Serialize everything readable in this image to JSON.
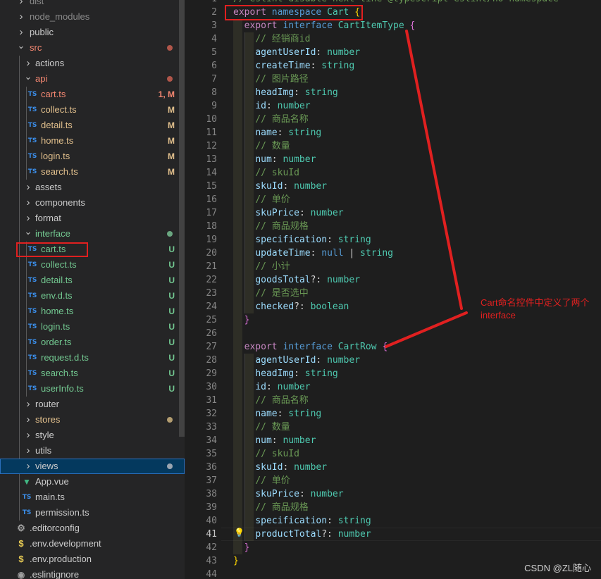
{
  "explorer": [
    {
      "label": "dist",
      "kind": "folder",
      "status": "muted"
    },
    {
      "label": "node_modules",
      "kind": "folder",
      "status": "muted"
    },
    {
      "label": "public",
      "kind": "folder"
    },
    {
      "label": "src",
      "kind": "folder-open",
      "status": "err",
      "badge": "dot"
    },
    {
      "label": "actions",
      "kind": "folder"
    },
    {
      "label": "api",
      "kind": "folder-open",
      "status": "err",
      "badge": "dot"
    },
    {
      "label": "cart.ts",
      "kind": "ts",
      "status": "err",
      "badge": "1, M"
    },
    {
      "label": "collect.ts",
      "kind": "ts",
      "status": "mod",
      "badge": "M"
    },
    {
      "label": "detail.ts",
      "kind": "ts",
      "status": "mod",
      "badge": "M"
    },
    {
      "label": "home.ts",
      "kind": "ts",
      "status": "mod",
      "badge": "M"
    },
    {
      "label": "login.ts",
      "kind": "ts",
      "status": "mod",
      "badge": "M"
    },
    {
      "label": "search.ts",
      "kind": "ts",
      "status": "mod",
      "badge": "M"
    },
    {
      "label": "assets",
      "kind": "folder"
    },
    {
      "label": "components",
      "kind": "folder"
    },
    {
      "label": "format",
      "kind": "folder"
    },
    {
      "label": "interface",
      "kind": "folder-open",
      "status": "unt",
      "badge": "dot"
    },
    {
      "label": "cart.ts",
      "kind": "ts",
      "status": "unt",
      "badge": "U"
    },
    {
      "label": "collect.ts",
      "kind": "ts",
      "status": "unt",
      "badge": "U"
    },
    {
      "label": "detail.ts",
      "kind": "ts",
      "status": "unt",
      "badge": "U"
    },
    {
      "label": "env.d.ts",
      "kind": "ts",
      "status": "unt",
      "badge": "U"
    },
    {
      "label": "home.ts",
      "kind": "ts",
      "status": "unt",
      "badge": "U"
    },
    {
      "label": "login.ts",
      "kind": "ts",
      "status": "unt",
      "badge": "U"
    },
    {
      "label": "order.ts",
      "kind": "ts",
      "status": "unt",
      "badge": "U"
    },
    {
      "label": "request.d.ts",
      "kind": "ts",
      "status": "unt",
      "badge": "U"
    },
    {
      "label": "search.ts",
      "kind": "ts",
      "status": "unt",
      "badge": "U"
    },
    {
      "label": "userInfo.ts",
      "kind": "ts",
      "status": "unt",
      "badge": "U"
    },
    {
      "label": "router",
      "kind": "folder"
    },
    {
      "label": "stores",
      "kind": "folder",
      "status": "mod",
      "badge": "dot"
    },
    {
      "label": "style",
      "kind": "folder"
    },
    {
      "label": "utils",
      "kind": "folder"
    },
    {
      "label": "views",
      "kind": "folder",
      "badge": "dot",
      "selected": true
    },
    {
      "label": "App.vue",
      "kind": "vue"
    },
    {
      "label": "main.ts",
      "kind": "ts"
    },
    {
      "label": "permission.ts",
      "kind": "ts"
    },
    {
      "label": ".editorconfig",
      "kind": "gear"
    },
    {
      "label": ".env.development",
      "kind": "env"
    },
    {
      "label": ".env.production",
      "kind": "env"
    },
    {
      "label": ".eslintignore",
      "kind": "dot"
    }
  ],
  "editor": {
    "active_line": 41,
    "lines": [
      {
        "n": 1,
        "t": [
          [
            "cm",
            "// eslint-disable-next-line @typescript-eslint/no-namespace"
          ]
        ]
      },
      {
        "n": 2,
        "t": [
          [
            "ctl",
            "export"
          ],
          [
            "pn",
            " "
          ],
          [
            "kw",
            "namespace"
          ],
          [
            "pn",
            " "
          ],
          [
            "ty",
            "Cart"
          ],
          [
            "pn",
            " "
          ],
          [
            "br1",
            "{"
          ]
        ]
      },
      {
        "n": 3,
        "t": [
          [
            "pn",
            "  "
          ],
          [
            "ctl",
            "export"
          ],
          [
            "pn",
            " "
          ],
          [
            "kw",
            "interface"
          ],
          [
            "pn",
            " "
          ],
          [
            "ty",
            "CartItemType"
          ],
          [
            "pn",
            " "
          ],
          [
            "br2",
            "{"
          ]
        ]
      },
      {
        "n": 4,
        "t": [
          [
            "pn",
            "    "
          ],
          [
            "cm",
            "// 经销商id"
          ]
        ]
      },
      {
        "n": 5,
        "t": [
          [
            "pn",
            "    "
          ],
          [
            "prop",
            "agentUserId"
          ],
          [
            "pn",
            ": "
          ],
          [
            "ty",
            "number"
          ]
        ]
      },
      {
        "n": 6,
        "t": [
          [
            "pn",
            "    "
          ],
          [
            "prop",
            "createTime"
          ],
          [
            "pn",
            ": "
          ],
          [
            "ty",
            "string"
          ]
        ]
      },
      {
        "n": 7,
        "t": [
          [
            "pn",
            "    "
          ],
          [
            "cm",
            "// 图片路径"
          ]
        ]
      },
      {
        "n": 8,
        "t": [
          [
            "pn",
            "    "
          ],
          [
            "prop",
            "headImg"
          ],
          [
            "pn",
            ": "
          ],
          [
            "ty",
            "string"
          ]
        ]
      },
      {
        "n": 9,
        "t": [
          [
            "pn",
            "    "
          ],
          [
            "prop",
            "id"
          ],
          [
            "pn",
            ": "
          ],
          [
            "ty",
            "number"
          ]
        ]
      },
      {
        "n": 10,
        "t": [
          [
            "pn",
            "    "
          ],
          [
            "cm",
            "// 商品名称"
          ]
        ]
      },
      {
        "n": 11,
        "t": [
          [
            "pn",
            "    "
          ],
          [
            "prop",
            "name"
          ],
          [
            "pn",
            ": "
          ],
          [
            "ty",
            "string"
          ]
        ]
      },
      {
        "n": 12,
        "t": [
          [
            "pn",
            "    "
          ],
          [
            "cm",
            "// 数量"
          ]
        ]
      },
      {
        "n": 13,
        "t": [
          [
            "pn",
            "    "
          ],
          [
            "prop",
            "num"
          ],
          [
            "pn",
            ": "
          ],
          [
            "ty",
            "number"
          ]
        ]
      },
      {
        "n": 14,
        "t": [
          [
            "pn",
            "    "
          ],
          [
            "cm",
            "// skuId"
          ]
        ]
      },
      {
        "n": 15,
        "t": [
          [
            "pn",
            "    "
          ],
          [
            "prop",
            "skuId"
          ],
          [
            "pn",
            ": "
          ],
          [
            "ty",
            "number"
          ]
        ]
      },
      {
        "n": 16,
        "t": [
          [
            "pn",
            "    "
          ],
          [
            "cm",
            "// 单价"
          ]
        ]
      },
      {
        "n": 17,
        "t": [
          [
            "pn",
            "    "
          ],
          [
            "prop",
            "skuPrice"
          ],
          [
            "pn",
            ": "
          ],
          [
            "ty",
            "number"
          ]
        ]
      },
      {
        "n": 18,
        "t": [
          [
            "pn",
            "    "
          ],
          [
            "cm",
            "// 商品规格"
          ]
        ]
      },
      {
        "n": 19,
        "t": [
          [
            "pn",
            "    "
          ],
          [
            "prop",
            "specification"
          ],
          [
            "pn",
            ": "
          ],
          [
            "ty",
            "string"
          ]
        ]
      },
      {
        "n": 20,
        "t": [
          [
            "pn",
            "    "
          ],
          [
            "prop",
            "updateTime"
          ],
          [
            "pn",
            ": "
          ],
          [
            "kw",
            "null"
          ],
          [
            "pn",
            " | "
          ],
          [
            "ty",
            "string"
          ]
        ]
      },
      {
        "n": 21,
        "t": [
          [
            "pn",
            "    "
          ],
          [
            "cm",
            "// 小计"
          ]
        ]
      },
      {
        "n": 22,
        "t": [
          [
            "pn",
            "    "
          ],
          [
            "prop",
            "goodsTotal"
          ],
          [
            "pn",
            "?: "
          ],
          [
            "ty",
            "number"
          ]
        ]
      },
      {
        "n": 23,
        "t": [
          [
            "pn",
            "    "
          ],
          [
            "cm",
            "// 是否选中"
          ]
        ]
      },
      {
        "n": 24,
        "t": [
          [
            "pn",
            "    "
          ],
          [
            "prop",
            "checked"
          ],
          [
            "pn",
            "?: "
          ],
          [
            "ty",
            "boolean"
          ]
        ]
      },
      {
        "n": 25,
        "t": [
          [
            "pn",
            "  "
          ],
          [
            "br2",
            "}"
          ]
        ]
      },
      {
        "n": 26,
        "t": []
      },
      {
        "n": 27,
        "t": [
          [
            "pn",
            "  "
          ],
          [
            "ctl",
            "export"
          ],
          [
            "pn",
            " "
          ],
          [
            "kw",
            "interface"
          ],
          [
            "pn",
            " "
          ],
          [
            "ty",
            "CartRow"
          ],
          [
            "pn",
            " "
          ],
          [
            "br2",
            "{"
          ]
        ]
      },
      {
        "n": 28,
        "t": [
          [
            "pn",
            "    "
          ],
          [
            "prop",
            "agentUserId"
          ],
          [
            "pn",
            ": "
          ],
          [
            "ty",
            "number"
          ]
        ]
      },
      {
        "n": 29,
        "t": [
          [
            "pn",
            "    "
          ],
          [
            "prop",
            "headImg"
          ],
          [
            "pn",
            ": "
          ],
          [
            "ty",
            "string"
          ]
        ]
      },
      {
        "n": 30,
        "t": [
          [
            "pn",
            "    "
          ],
          [
            "prop",
            "id"
          ],
          [
            "pn",
            ": "
          ],
          [
            "ty",
            "number"
          ]
        ]
      },
      {
        "n": 31,
        "t": [
          [
            "pn",
            "    "
          ],
          [
            "cm",
            "// 商品名称"
          ]
        ]
      },
      {
        "n": 32,
        "t": [
          [
            "pn",
            "    "
          ],
          [
            "prop",
            "name"
          ],
          [
            "pn",
            ": "
          ],
          [
            "ty",
            "string"
          ]
        ]
      },
      {
        "n": 33,
        "t": [
          [
            "pn",
            "    "
          ],
          [
            "cm",
            "// 数量"
          ]
        ]
      },
      {
        "n": 34,
        "t": [
          [
            "pn",
            "    "
          ],
          [
            "prop",
            "num"
          ],
          [
            "pn",
            ": "
          ],
          [
            "ty",
            "number"
          ]
        ]
      },
      {
        "n": 35,
        "t": [
          [
            "pn",
            "    "
          ],
          [
            "cm",
            "// skuId"
          ]
        ]
      },
      {
        "n": 36,
        "t": [
          [
            "pn",
            "    "
          ],
          [
            "prop",
            "skuId"
          ],
          [
            "pn",
            ": "
          ],
          [
            "ty",
            "number"
          ]
        ]
      },
      {
        "n": 37,
        "t": [
          [
            "pn",
            "    "
          ],
          [
            "cm",
            "// 单价"
          ]
        ]
      },
      {
        "n": 38,
        "t": [
          [
            "pn",
            "    "
          ],
          [
            "prop",
            "skuPrice"
          ],
          [
            "pn",
            ": "
          ],
          [
            "ty",
            "number"
          ]
        ]
      },
      {
        "n": 39,
        "t": [
          [
            "pn",
            "    "
          ],
          [
            "cm",
            "// 商品规格"
          ]
        ]
      },
      {
        "n": 40,
        "t": [
          [
            "pn",
            "    "
          ],
          [
            "prop",
            "specification"
          ],
          [
            "pn",
            ": "
          ],
          [
            "ty",
            "string"
          ]
        ]
      },
      {
        "n": 41,
        "t": [
          [
            "pn",
            "    "
          ],
          [
            "prop",
            "productTotal"
          ],
          [
            "pn",
            "?: "
          ],
          [
            "ty",
            "number"
          ]
        ]
      },
      {
        "n": 42,
        "t": [
          [
            "pn",
            "  "
          ],
          [
            "br2",
            "}"
          ]
        ]
      },
      {
        "n": 43,
        "t": [
          [
            "br1",
            "}"
          ]
        ]
      },
      {
        "n": 44,
        "t": []
      }
    ]
  },
  "annotation": {
    "text": "Cart命名控件中定义了两个interface",
    "color": "#e02020"
  },
  "watermark": "CSDN @ZL随心"
}
